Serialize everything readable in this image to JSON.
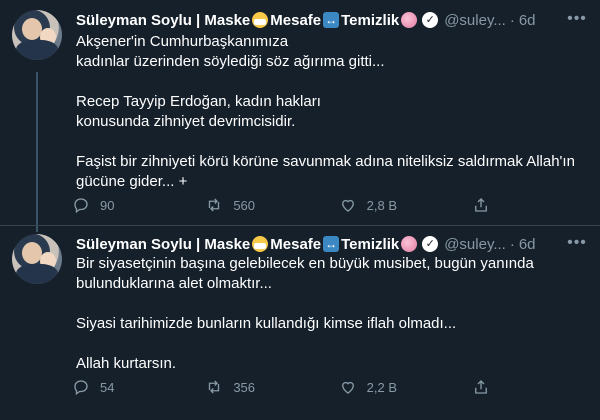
{
  "tweets": [
    {
      "author": {
        "name": "Süleyman Soylu | Maske",
        "name_mid": "Mesafe",
        "name_end": "Temizlik",
        "handle": "@suley...",
        "time": "6d"
      },
      "more_icon": "more-dots-icon",
      "lines": [
        "Akşener'in Cumhurbaşkanımıza",
        "kadınlar üzerinden söylediği söz ağırıma gitti...",
        "",
        "Recep Tayyip Erdoğan, kadın hakları",
        "konusunda zihniyet devrimcisidir.",
        "",
        "Faşist bir zihniyeti körü körüne savunmak adına niteliksiz saldırmak Allah'ın",
        "gücüne gider... +"
      ],
      "stats": {
        "replies": "90",
        "retweets": "560",
        "likes": "2,8 B"
      }
    },
    {
      "author": {
        "name": "Süleyman Soylu | Maske",
        "name_mid": "Mesafe",
        "name_end": "Temizlik",
        "handle": "@suley...",
        "time": "6d"
      },
      "more_icon": "more-dots-icon",
      "lines": [
        "Bir siyasetçinin başına gelebilecek en büyük musibet, bugün yanında",
        "bulunduklarına alet olmaktır...",
        "",
        "Siyasi tarihimizde bunların kullandığı kimse iflah olmadı...",
        "",
        "Allah kurtarsın."
      ],
      "stats": {
        "replies": "54",
        "retweets": "356",
        "likes": "2,2 B"
      }
    }
  ],
  "colors": {
    "background": "#15202b",
    "muted": "#8899a6",
    "text": "#ffffff",
    "divider": "#38444d"
  }
}
